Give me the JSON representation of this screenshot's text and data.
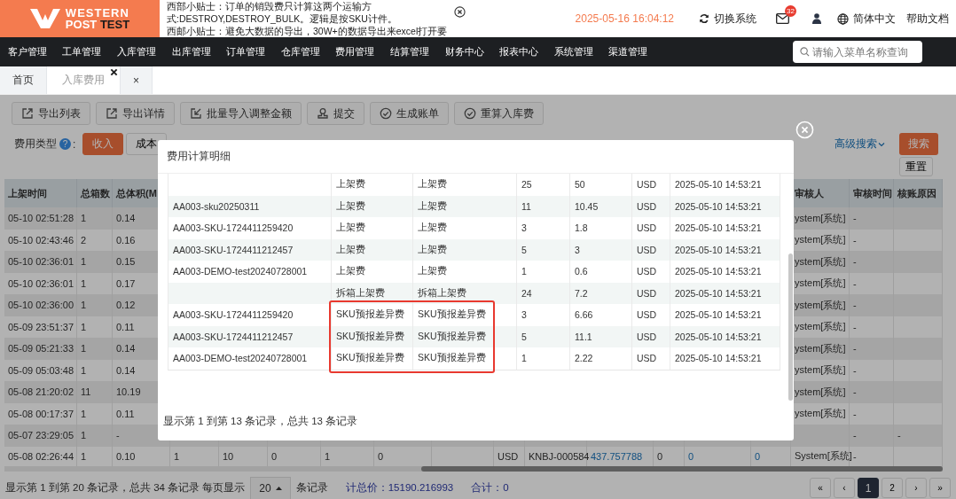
{
  "header": {
    "logo": {
      "line1": "WESTERN",
      "line2": "POST",
      "line2_bold": "TEST"
    },
    "notice_lines": [
      "西部小贴士：订单的销毁费只计算这两个运输方",
      "式:DESTROY,DESTROY_BULK。逻辑是按SKU计件。",
      "西邮小贴士：避免大数据的导出，30W+的数据导出来excel打开要"
    ],
    "datetime": "2025-05-16 16:04:12",
    "switch_label": "切换系统",
    "mail_badge": "32",
    "language": "简体中文",
    "help": "帮助文档"
  },
  "nav": {
    "items": [
      "客户管理",
      "工单管理",
      "入库管理",
      "出库管理",
      "订单管理",
      "仓库管理",
      "费用管理",
      "结算管理",
      "财务中心",
      "报表中心",
      "系统管理",
      "渠道管理"
    ],
    "search": {
      "placeholder": "请输入菜单名称查询"
    }
  },
  "tabs": [
    {
      "label": "首页",
      "selected": false,
      "closable": false
    },
    {
      "label": "入库费用",
      "selected": true,
      "closable": true
    },
    {
      "label": "×",
      "selected": false,
      "closable": false
    }
  ],
  "toolbar": [
    {
      "label": "导出列表",
      "kind": "export"
    },
    {
      "label": "导出详情",
      "kind": "export"
    },
    {
      "label": "批量导入调整金额",
      "kind": "import"
    },
    {
      "label": "提交",
      "kind": "submit"
    },
    {
      "label": "生成账单",
      "kind": "check"
    },
    {
      "label": "重算入库费",
      "kind": "check"
    }
  ],
  "filters": {
    "label": "费用类型",
    "help_mark": "?",
    "label_suffix": ":",
    "fee_types": [
      {
        "label": "收入",
        "selected": true
      },
      {
        "label": "成本",
        "selected": false
      }
    ],
    "advanced_search": "高级搜索",
    "search_button": "搜索",
    "reset_button": "重置"
  },
  "table": {
    "columns": [
      "上架时间",
      "总箱数",
      "总体积(M",
      null,
      null,
      null,
      null,
      null,
      null,
      null,
      null,
      null,
      null,
      null,
      null,
      "审核人",
      "审核时间",
      "核账原因"
    ],
    "rows": [
      {
        "cells": [
          "05-10 02:51:28",
          "1",
          "0.14",
          null,
          null,
          null,
          null,
          null,
          null,
          null,
          null,
          null,
          null,
          null,
          null,
          "ystem[系统]",
          "-",
          null
        ]
      },
      {
        "cells": [
          "05-10 02:43:46",
          "2",
          "0.16",
          null,
          null,
          null,
          null,
          null,
          null,
          null,
          null,
          null,
          null,
          null,
          null,
          "ystem[系统]",
          "-",
          null
        ]
      },
      {
        "cells": [
          "05-10 02:36:01",
          "1",
          "0.15",
          null,
          null,
          null,
          null,
          null,
          null,
          null,
          null,
          null,
          null,
          null,
          null,
          "ystem[系统]",
          "-",
          null
        ]
      },
      {
        "cells": [
          "05-10 02:36:01",
          "1",
          "0.17",
          null,
          null,
          null,
          null,
          null,
          null,
          null,
          null,
          null,
          null,
          null,
          null,
          "ystem[系统]",
          "-",
          null
        ]
      },
      {
        "cells": [
          "05-10 02:36:00",
          "1",
          "0.12",
          null,
          null,
          null,
          null,
          null,
          null,
          null,
          null,
          null,
          null,
          null,
          null,
          "ystem[系统]",
          "-",
          null
        ]
      },
      {
        "cells": [
          "05-09 23:51:37",
          "1",
          "0.11",
          null,
          null,
          null,
          null,
          null,
          null,
          null,
          null,
          null,
          null,
          null,
          null,
          "ystem[系统]",
          "-",
          null
        ]
      },
      {
        "cells": [
          "05-09 05:21:33",
          "1",
          "0.14",
          null,
          null,
          null,
          null,
          null,
          null,
          null,
          null,
          null,
          null,
          null,
          null,
          "ystem[系统]",
          "-",
          null
        ]
      },
      {
        "cells": [
          "05-09 05:03:48",
          "1",
          "0.14",
          null,
          null,
          null,
          null,
          null,
          null,
          null,
          null,
          null,
          null,
          null,
          null,
          "ystem[系统]",
          "-",
          null
        ]
      },
      {
        "cells": [
          "05-08 21:20:02",
          "11",
          "10.19",
          null,
          null,
          null,
          null,
          null,
          null,
          null,
          null,
          null,
          null,
          null,
          null,
          "ystem[系统]",
          "-",
          null
        ]
      },
      {
        "cells": [
          "05-08 00:17:37",
          "1",
          "0.11",
          null,
          null,
          null,
          null,
          null,
          null,
          null,
          null,
          null,
          null,
          null,
          null,
          "ystem[系统]",
          "-",
          null
        ]
      },
      {
        "cells": [
          "05-07 23:29:05",
          "1",
          "-",
          null,
          null,
          null,
          null,
          null,
          null,
          null,
          null,
          null,
          null,
          null,
          null,
          null,
          "-",
          "-"
        ]
      },
      {
        "cells": [
          "05-08 02:26:44",
          "1",
          "0.10",
          "1",
          "10",
          "0",
          "1",
          "0",
          null,
          "USD",
          "KNBJ-000584",
          {
            "text": "437.757788",
            "link": true
          },
          "0",
          {
            "text": "0",
            "link": true
          },
          {
            "text": "0",
            "link": true
          },
          "System[系统]",
          "-",
          null
        ]
      }
    ]
  },
  "footer": {
    "summary": "显示第 1 到第 20 条记录，总共 34 条记录 每页显示",
    "page_size": "20",
    "page_size_suffix": "条记录",
    "total_price": "计总价：15190.216993",
    "total": "合计：0",
    "pagination": [
      {
        "label": "«",
        "selected": false
      },
      {
        "label": "‹",
        "selected": false
      },
      {
        "label": "1",
        "selected": true
      },
      {
        "label": "2",
        "selected": false
      },
      {
        "label": "›",
        "selected": false
      },
      {
        "label": "»",
        "selected": false
      }
    ]
  },
  "modal": {
    "title": "费用计算明细",
    "rows": [
      {
        "cells": [
          null,
          "上架费",
          "上架费",
          "25",
          "50",
          "USD",
          "2025-05-10 14:53:21"
        ],
        "flagged": false
      },
      {
        "cells": [
          "AA003-sku20250311",
          "上架费",
          "上架费",
          "11",
          "10.45",
          "USD",
          "2025-05-10 14:53:21"
        ],
        "flagged": false
      },
      {
        "cells": [
          "AA003-SKU-1724411259420",
          "上架费",
          "上架费",
          "3",
          "1.8",
          "USD",
          "2025-05-10 14:53:21"
        ],
        "flagged": false
      },
      {
        "cells": [
          "AA003-SKU-1724411212457",
          "上架费",
          "上架费",
          "5",
          "3",
          "USD",
          "2025-05-10 14:53:21"
        ],
        "flagged": false
      },
      {
        "cells": [
          "AA003-DEMO-test20240728001",
          "上架费",
          "上架费",
          "1",
          "0.6",
          "USD",
          "2025-05-10 14:53:21"
        ],
        "flagged": false
      },
      {
        "cells": [
          null,
          "拆箱上架费",
          "拆箱上架费",
          "24",
          "7.2",
          "USD",
          "2025-05-10 14:53:21"
        ],
        "flagged": false
      },
      {
        "cells": [
          "AA003-SKU-1724411259420",
          "SKU预报差异费",
          "SKU预报差异费",
          "3",
          "6.66",
          "USD",
          "2025-05-10 14:53:21"
        ],
        "flagged": true
      },
      {
        "cells": [
          "AA003-SKU-1724411212457",
          "SKU预报差异费",
          "SKU预报差异费",
          "5",
          "11.1",
          "USD",
          "2025-05-10 14:53:21"
        ],
        "flagged": true
      },
      {
        "cells": [
          "AA003-DEMO-test20240728001",
          "SKU预报差异费",
          "SKU预报差异费",
          "1",
          "2.22",
          "USD",
          "2025-05-10 14:53:21"
        ],
        "flagged": true
      }
    ],
    "summary": "显示第 1 到第 13 条记录，总共 13 条记录"
  }
}
